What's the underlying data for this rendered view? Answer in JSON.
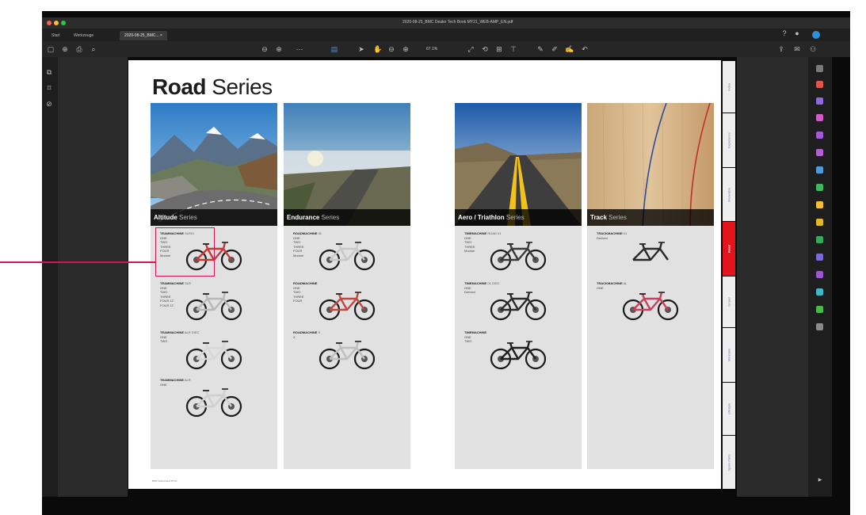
{
  "window": {
    "title": "2020-08-25_BMC Dealer Tech Book MY21_WEB-AMP_EN.pdf",
    "traffic_colors": [
      "#ff5f57",
      "#febc2e",
      "#28c840"
    ]
  },
  "tabs": [
    {
      "label": "Start"
    },
    {
      "label": "Werkzeuge"
    },
    {
      "label": "2020-08-25_BMC... ×"
    }
  ],
  "toolbar": {
    "zoom": "67.1%"
  },
  "page": {
    "heading_bold": "Road",
    "heading_light": "Series",
    "footer": "BMC Switzerland MY21"
  },
  "series": [
    {
      "caption_bold": "Altitude",
      "caption_light": "Series",
      "photo": "mountain-road",
      "bikes": [
        {
          "name": "TEAMMACHINE",
          "sub": "SLR01",
          "options": [
            "ONE",
            "TWO",
            "THREE",
            "FOUR",
            "Module"
          ],
          "frame_color": "#c23a3a"
        },
        {
          "name": "TEAMMACHINE",
          "sub": "SLR",
          "options": [
            "ONE",
            "TWO",
            "THREE",
            "FOUR 12",
            "FOUR 12"
          ],
          "frame_color": "#b8b8b8"
        },
        {
          "name": "TEAMMACHINE",
          "sub": "ALR DISC",
          "options": [
            "ONE",
            "TWO"
          ],
          "frame_color": "#d7d7d7"
        },
        {
          "name": "TEAMMACHINE",
          "sub": "ALR",
          "options": [
            "ONE"
          ],
          "frame_color": "#cfcfcf"
        }
      ]
    },
    {
      "caption_bold": "Endurance",
      "caption_light": "Series",
      "photo": "foggy-valley",
      "bikes": [
        {
          "name": "ROADMACHINE",
          "sub": "01",
          "options": [
            "ONE",
            "TWO",
            "THREE",
            "FOUR",
            "Module"
          ],
          "frame_color": "#c8c8c8"
        },
        {
          "name": "ROADMACHINE",
          "sub": "",
          "options": [
            "ONE",
            "TWO",
            "THREE",
            "FOUR"
          ],
          "frame_color": "#c0483f"
        },
        {
          "name": "ROADMACHINE",
          "sub": "X",
          "options": [
            "X"
          ],
          "frame_color": "#bfbfbf"
        }
      ]
    },
    {
      "caption_bold": "Aero / Triathlon",
      "caption_light": "Series",
      "photo": "desert-road",
      "bikes": [
        {
          "name": "TIMEMACHINE",
          "sub": "ROAD 01",
          "options": [
            "ONE",
            "TWO",
            "THREE",
            "Module"
          ],
          "frame_color": "#3a3a3a"
        },
        {
          "name": "TIMEMACHINE",
          "sub": "01 DISC",
          "options": [
            "ONE",
            "Derived"
          ],
          "frame_color": "#2c2c2c"
        },
        {
          "name": "TIMEMACHINE",
          "sub": "",
          "options": [
            "ONE",
            "TWO"
          ],
          "frame_color": "#1f1f1f"
        }
      ]
    },
    {
      "caption_bold": "Track",
      "caption_light": "Series",
      "photo": "velodrome",
      "bikes": [
        {
          "name": "TRACKMACHINE",
          "sub": "01",
          "options": [
            "Derived"
          ],
          "frame_color": "#2a2a2a"
        },
        {
          "name": "TRACKMACHINE",
          "sub": "AL",
          "options": [
            "ONE"
          ],
          "frame_color": "#c8405a"
        }
      ]
    }
  ],
  "side_tabs": [
    {
      "label": "Index",
      "active": false
    },
    {
      "label": "Experience",
      "active": false
    },
    {
      "label": "Innovation",
      "active": false
    },
    {
      "label": "Road",
      "active": true
    },
    {
      "label": "Gravel",
      "active": false
    },
    {
      "label": "Mountain",
      "active": false
    },
    {
      "label": "Lifestyle",
      "active": false
    },
    {
      "label": "Spare Parts",
      "active": false
    }
  ],
  "colors": {
    "accent": "#d4145a",
    "active_tab": "#e3141c"
  }
}
